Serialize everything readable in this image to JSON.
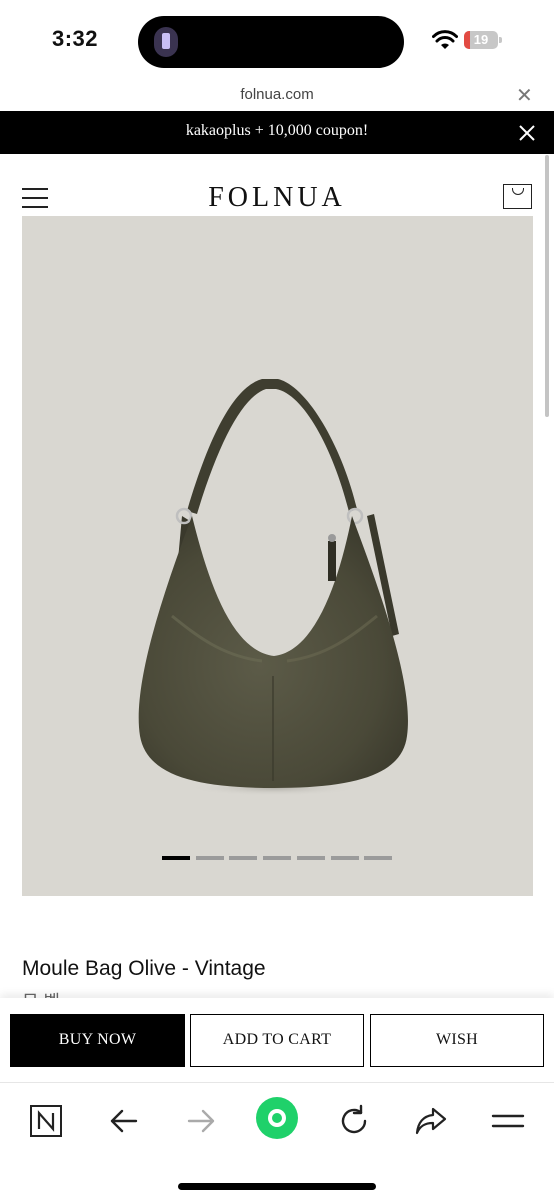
{
  "status_bar": {
    "time": "3:32",
    "battery_level": "19",
    "battery_percent": 19,
    "icons": [
      "flashlight-icon",
      "wifi-icon",
      "battery-icon"
    ]
  },
  "browser": {
    "url": "folnua.com",
    "close_icon": "close-icon"
  },
  "promo": {
    "text": "kakaoplus + 10,000 coupon!",
    "close_icon": "close-icon"
  },
  "header": {
    "logo": "FOLNUA",
    "menu_icon": "hamburger-menu-icon",
    "cart_icon": "shopping-bag-icon"
  },
  "product": {
    "title": "Moule Bag Olive - Vintage",
    "subtitle": "무 벨",
    "image_count": 7,
    "active_image": 1,
    "image_bg": "#d9d7d1",
    "bag_color": "#4d4c3c"
  },
  "actions": {
    "buy_now": "BUY NOW",
    "add_to_cart": "ADD TO CART",
    "wish": "WISH"
  },
  "toolbar": {
    "icons": [
      "naver-home-icon",
      "back-arrow-icon",
      "forward-arrow-icon",
      "green-circle-icon",
      "reload-icon",
      "share-icon",
      "menu-icon"
    ],
    "accent": "#1fd16a"
  }
}
